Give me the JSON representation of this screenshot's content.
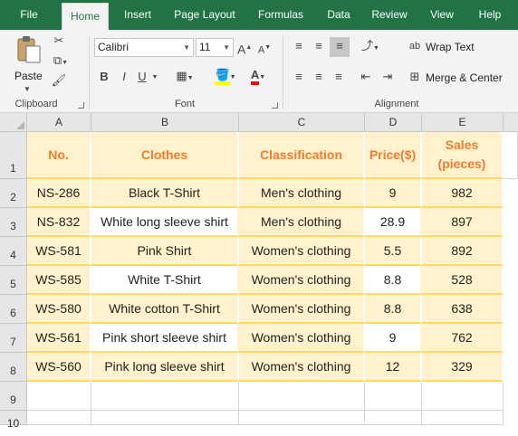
{
  "ribbon_tabs": [
    "File",
    "Home",
    "Insert",
    "Page Layout",
    "Formulas",
    "Data",
    "Review",
    "View",
    "Help"
  ],
  "active_tab": "Home",
  "clipboard": {
    "paste_label": "Paste",
    "group_label": "Clipboard"
  },
  "font": {
    "name": "Calibri",
    "size": "11",
    "bold": "B",
    "italic": "I",
    "underline": "U",
    "grow": "A",
    "shrink": "A",
    "group_label": "Font"
  },
  "alignment": {
    "wrap_text": "Wrap Text",
    "merge_center": "Merge & Center",
    "group_label": "Alignment"
  },
  "columns": [
    "A",
    "B",
    "C",
    "D",
    "E"
  ],
  "rows": [
    "1",
    "2",
    "3",
    "4",
    "5",
    "6",
    "7",
    "8",
    "9",
    "10"
  ],
  "table": {
    "headers": [
      "No.",
      "Clothes",
      "Classification",
      "Price($)",
      "Sales\n(pieces)"
    ],
    "rows": [
      [
        "NS-286",
        "Black T-Shirt",
        "Men's clothing",
        "9",
        "982"
      ],
      [
        "NS-832",
        "White long sleeve shirt",
        "Men's clothing",
        "28.9",
        "897"
      ],
      [
        "WS-581",
        "Pink Shirt",
        "Women's clothing",
        "5.5",
        "892"
      ],
      [
        "WS-585",
        "White T-Shirt",
        "Women's clothing",
        "8.8",
        "528"
      ],
      [
        "WS-580",
        "White cotton T-Shirt",
        "Women's clothing",
        "8.8",
        "638"
      ],
      [
        "WS-561",
        "Pink short sleeve shirt",
        "Women's clothing",
        "9",
        "762"
      ],
      [
        "WS-560",
        "Pink long sleeve shirt",
        "Women's clothing",
        "12",
        "329"
      ]
    ]
  },
  "colors": {
    "ribbon_green": "#217346",
    "header_text": "#ed7d31",
    "band_fill": "#fff2cc",
    "band_border": "#ffd966"
  }
}
